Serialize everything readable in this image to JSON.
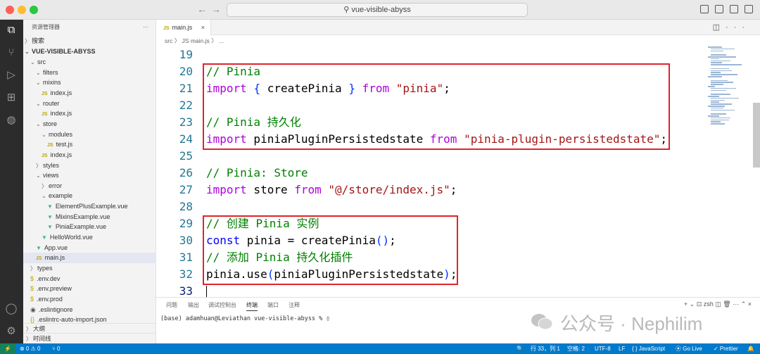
{
  "titlebar": {
    "search_text": "⚲ vue-visible-abyss",
    "back_arrow": "←",
    "forward_arrow": "→"
  },
  "sidebar": {
    "header": "资源管理器",
    "more": "···",
    "search_section": "搜索",
    "root": "VUE-VISIBLE-ABYSS",
    "items": [
      {
        "label": "src",
        "kind": "folder-open",
        "indent": 1
      },
      {
        "label": "filters",
        "kind": "folder-open",
        "indent": 2
      },
      {
        "label": "mixins",
        "kind": "folder-open",
        "indent": 2
      },
      {
        "label": "index.js",
        "kind": "js",
        "indent": 3
      },
      {
        "label": "router",
        "kind": "folder-open",
        "indent": 2
      },
      {
        "label": "index.js",
        "kind": "js",
        "indent": 3
      },
      {
        "label": "store",
        "kind": "folder-open",
        "indent": 2
      },
      {
        "label": "modules",
        "kind": "folder-open",
        "indent": 3
      },
      {
        "label": "test.js",
        "kind": "js",
        "indent": 4
      },
      {
        "label": "index.js",
        "kind": "js",
        "indent": 3
      },
      {
        "label": "styles",
        "kind": "folder-closed",
        "indent": 2
      },
      {
        "label": "views",
        "kind": "folder-open",
        "indent": 2
      },
      {
        "label": "error",
        "kind": "folder-closed",
        "indent": 3
      },
      {
        "label": "example",
        "kind": "folder-open",
        "indent": 3
      },
      {
        "label": "ElementPlusExample.vue",
        "kind": "vue",
        "indent": 4
      },
      {
        "label": "MixinsExample.vue",
        "kind": "vue",
        "indent": 4
      },
      {
        "label": "PiniaExample.vue",
        "kind": "vue",
        "indent": 4
      },
      {
        "label": "HelloWorld.vue",
        "kind": "vue",
        "indent": 3
      },
      {
        "label": "App.vue",
        "kind": "vue",
        "indent": 2
      },
      {
        "label": "main.js",
        "kind": "js",
        "indent": 2,
        "selected": true
      },
      {
        "label": "types",
        "kind": "folder-closed",
        "indent": 1
      },
      {
        "label": ".env.dev",
        "kind": "env",
        "indent": 1
      },
      {
        "label": ".env.preview",
        "kind": "env",
        "indent": 1
      },
      {
        "label": ".env.prod",
        "kind": "env",
        "indent": 1
      },
      {
        "label": ".eslintignore",
        "kind": "gear",
        "indent": 1
      },
      {
        "label": ".eslintrc-auto-import.json",
        "kind": "json",
        "indent": 1
      }
    ],
    "outline": "大纲",
    "timeline": "时间线"
  },
  "editor": {
    "tab_label": "main.js",
    "tab_close": "×",
    "breadcrumb": "src  〉 JS main.js 〉 ...",
    "lines": [
      {
        "n": "19",
        "tokens": []
      },
      {
        "n": "20",
        "tokens": [
          {
            "t": "// Pinia",
            "c": "cmt"
          }
        ]
      },
      {
        "n": "21",
        "tokens": [
          {
            "t": "import",
            "c": "kw2"
          },
          {
            "t": " "
          },
          {
            "t": "{",
            "c": "br1"
          },
          {
            "t": " createPinia "
          },
          {
            "t": "}",
            "c": "br1"
          },
          {
            "t": " "
          },
          {
            "t": "from",
            "c": "kw2"
          },
          {
            "t": " "
          },
          {
            "t": "\"pinia\"",
            "c": "str"
          },
          {
            "t": ";"
          }
        ]
      },
      {
        "n": "22",
        "tokens": []
      },
      {
        "n": "23",
        "tokens": [
          {
            "t": "// Pinia 持久化",
            "c": "cmt"
          }
        ]
      },
      {
        "n": "24",
        "tokens": [
          {
            "t": "import",
            "c": "kw2"
          },
          {
            "t": " piniaPluginPersistedstate "
          },
          {
            "t": "from",
            "c": "kw2"
          },
          {
            "t": " "
          },
          {
            "t": "\"pinia-plugin-persistedstate\"",
            "c": "str"
          },
          {
            "t": ";"
          }
        ]
      },
      {
        "n": "25",
        "tokens": []
      },
      {
        "n": "26",
        "tokens": [
          {
            "t": "// Pinia: Store",
            "c": "cmt"
          }
        ]
      },
      {
        "n": "27",
        "tokens": [
          {
            "t": "import",
            "c": "kw2"
          },
          {
            "t": " store "
          },
          {
            "t": "from",
            "c": "kw2"
          },
          {
            "t": " "
          },
          {
            "t": "\"@/store/index.js\"",
            "c": "str"
          },
          {
            "t": ";"
          }
        ]
      },
      {
        "n": "28",
        "tokens": []
      },
      {
        "n": "29",
        "tokens": [
          {
            "t": "// 创建 Pinia 实例",
            "c": "cmt"
          }
        ]
      },
      {
        "n": "30",
        "tokens": [
          {
            "t": "const",
            "c": "kw"
          },
          {
            "t": " pinia = createPinia"
          },
          {
            "t": "()",
            "c": "br1"
          },
          {
            "t": ";"
          }
        ]
      },
      {
        "n": "31",
        "tokens": [
          {
            "t": "// 添加 Pinia 持久化插件",
            "c": "cmt"
          }
        ]
      },
      {
        "n": "32",
        "tokens": [
          {
            "t": "pinia.use"
          },
          {
            "t": "(",
            "c": "br1"
          },
          {
            "t": "piniaPluginPersistedstate"
          },
          {
            "t": ")",
            "c": "br1"
          },
          {
            "t": ";"
          }
        ]
      },
      {
        "n": "33",
        "tokens": []
      }
    ]
  },
  "panel": {
    "tabs": [
      "问题",
      "输出",
      "调试控制台",
      "终端",
      "端口",
      "注释"
    ],
    "active_tab": "终端",
    "actions": "+ ⌄  ⊡ zsh  ◫  🗑  ···  ⌃  ×",
    "terminal_line": "(base) adamhuan@Leviathan vue-visible-abyss % ▯"
  },
  "watermark": "公众号 · Nephilim",
  "status": {
    "remote": "⚡",
    "problems": "⊗ 0 ⚠ 0",
    "ports": "⑂ 0",
    "zoom": "🔍",
    "position": "行 33，列 1",
    "spaces": "空格: 2",
    "encoding": "UTF-8",
    "eol": "LF",
    "language": "{ } JavaScript",
    "golive": "⦿ Go Live",
    "prettier": "✓ Prettier",
    "bell": "🔔"
  },
  "colors": {
    "highlight_box": "#e0242b",
    "statusbar": "#007acc",
    "comment": "#008000",
    "keyword": "#af00db",
    "string": "#a31515"
  }
}
